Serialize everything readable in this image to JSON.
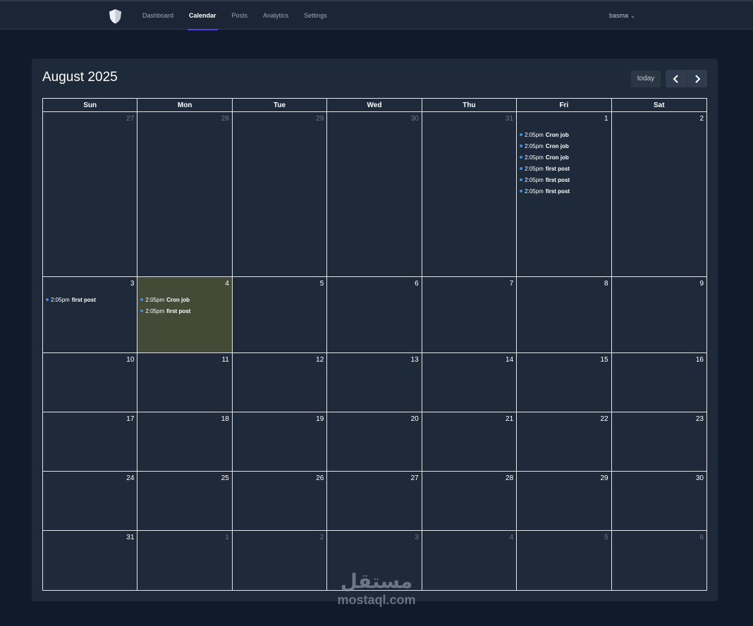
{
  "nav": {
    "items": [
      {
        "label": "Dashboard",
        "active": false
      },
      {
        "label": "Calendar",
        "active": true
      },
      {
        "label": "Posts",
        "active": false
      },
      {
        "label": "Analytics",
        "active": false
      },
      {
        "label": "Settings",
        "active": false
      }
    ],
    "user": "basma"
  },
  "calendar": {
    "title": "August 2025",
    "today_label": "today",
    "weekdays": [
      "Sun",
      "Mon",
      "Tue",
      "Wed",
      "Thu",
      "Fri",
      "Sat"
    ],
    "weeks": [
      [
        {
          "day": "27",
          "other": true,
          "events": []
        },
        {
          "day": "28",
          "other": true,
          "events": []
        },
        {
          "day": "29",
          "other": true,
          "events": []
        },
        {
          "day": "30",
          "other": true,
          "events": []
        },
        {
          "day": "31",
          "other": true,
          "events": []
        },
        {
          "day": "1",
          "other": false,
          "events": [
            {
              "time": "2:05pm",
              "title": "Cron job"
            },
            {
              "time": "2:05pm",
              "title": "Cron job"
            },
            {
              "time": "2:05pm",
              "title": "Cron job"
            },
            {
              "time": "2:05pm",
              "title": "first post"
            },
            {
              "time": "2:05pm",
              "title": "first post"
            },
            {
              "time": "2:05pm",
              "title": "first post"
            }
          ]
        },
        {
          "day": "2",
          "other": false,
          "events": []
        }
      ],
      [
        {
          "day": "3",
          "other": false,
          "events": [
            {
              "time": "2:05pm",
              "title": "first post"
            }
          ]
        },
        {
          "day": "4",
          "other": false,
          "today": true,
          "events": [
            {
              "time": "2:05pm",
              "title": "Cron job"
            },
            {
              "time": "2:05pm",
              "title": "first post"
            }
          ]
        },
        {
          "day": "5",
          "other": false,
          "events": []
        },
        {
          "day": "6",
          "other": false,
          "events": []
        },
        {
          "day": "7",
          "other": false,
          "events": []
        },
        {
          "day": "8",
          "other": false,
          "events": []
        },
        {
          "day": "9",
          "other": false,
          "events": []
        }
      ],
      [
        {
          "day": "10",
          "other": false,
          "events": []
        },
        {
          "day": "11",
          "other": false,
          "events": []
        },
        {
          "day": "12",
          "other": false,
          "events": []
        },
        {
          "day": "13",
          "other": false,
          "events": []
        },
        {
          "day": "14",
          "other": false,
          "events": []
        },
        {
          "day": "15",
          "other": false,
          "events": []
        },
        {
          "day": "16",
          "other": false,
          "events": []
        }
      ],
      [
        {
          "day": "17",
          "other": false,
          "events": []
        },
        {
          "day": "18",
          "other": false,
          "events": []
        },
        {
          "day": "19",
          "other": false,
          "events": []
        },
        {
          "day": "20",
          "other": false,
          "events": []
        },
        {
          "day": "21",
          "other": false,
          "events": []
        },
        {
          "day": "22",
          "other": false,
          "events": []
        },
        {
          "day": "23",
          "other": false,
          "events": []
        }
      ],
      [
        {
          "day": "24",
          "other": false,
          "events": []
        },
        {
          "day": "25",
          "other": false,
          "events": []
        },
        {
          "day": "26",
          "other": false,
          "events": []
        },
        {
          "day": "27",
          "other": false,
          "events": []
        },
        {
          "day": "28",
          "other": false,
          "events": []
        },
        {
          "day": "29",
          "other": false,
          "events": []
        },
        {
          "day": "30",
          "other": false,
          "events": []
        }
      ],
      [
        {
          "day": "31",
          "other": false,
          "events": []
        },
        {
          "day": "1",
          "other": true,
          "events": []
        },
        {
          "day": "2",
          "other": true,
          "events": []
        },
        {
          "day": "3",
          "other": true,
          "events": []
        },
        {
          "day": "4",
          "other": true,
          "events": []
        },
        {
          "day": "5",
          "other": true,
          "events": []
        },
        {
          "day": "6",
          "other": true,
          "events": []
        }
      ]
    ]
  },
  "watermark": {
    "arabic": "مستقل",
    "latin": "mostaql.com"
  },
  "colors": {
    "event_dot": "#3b8fe8",
    "today_bg": "#444a36",
    "accent": "#4b46d6"
  },
  "icons": {
    "logo": "shield-icon",
    "prev": "chevron-left-icon",
    "next": "chevron-right-icon",
    "user_menu": "chevron-down-icon"
  }
}
